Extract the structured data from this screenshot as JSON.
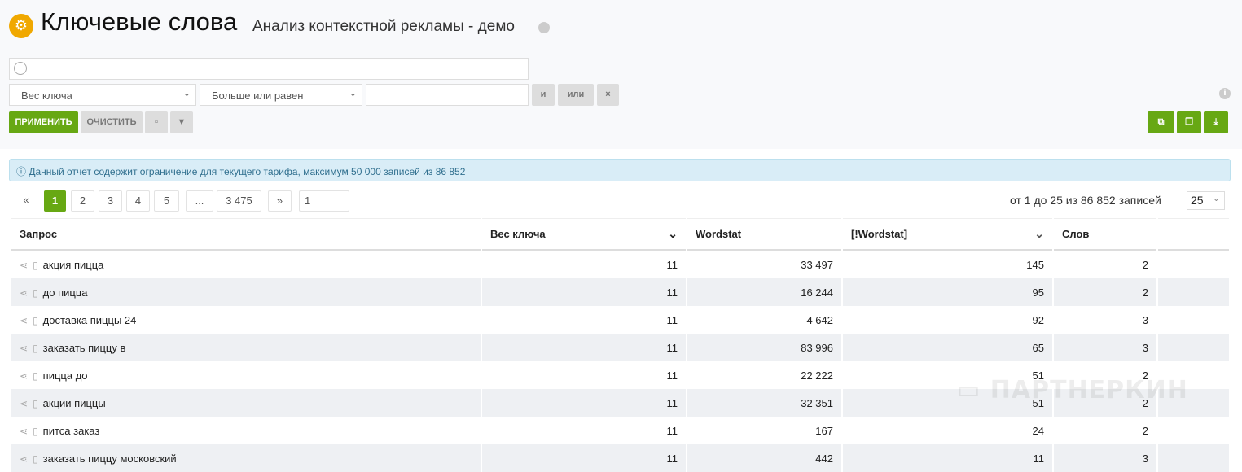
{
  "header": {
    "title": "Ключевые слова",
    "subtitle": "Анализ контекстной рекламы - демо"
  },
  "filters": {
    "search_placeholder": "",
    "field_select": "Вес ключа",
    "operator_select": "Больше или равен",
    "value": "",
    "and_label": "и",
    "or_label": "или",
    "remove_label": "×",
    "apply_label": "ПРИМЕНИТЬ",
    "clear_label": "ОЧИСТИТЬ"
  },
  "alert": "Данный отчет содержит ограничение для текущего тарифа, максимум 50 000 записей из 86 852",
  "pagination": {
    "prev": "«",
    "pages": [
      "1",
      "2",
      "3",
      "4",
      "5",
      "...",
      "3 475"
    ],
    "next": "»",
    "goto": "1",
    "records_info": "от 1 до 25 из 86 852 записей",
    "per_page": "25"
  },
  "table": {
    "columns": [
      "Запрос",
      "Вес ключа",
      "Wordstat",
      "[!Wordstat]",
      "Слов"
    ],
    "rows": [
      [
        "акция пицца",
        "11",
        "33 497",
        "145",
        "2"
      ],
      [
        "до пицца",
        "11",
        "16 244",
        "95",
        "2"
      ],
      [
        "доставка пиццы 24",
        "11",
        "4 642",
        "92",
        "3"
      ],
      [
        "заказать пиццу в",
        "11",
        "83 996",
        "65",
        "3"
      ],
      [
        "пицца до",
        "11",
        "22 222",
        "51",
        "2"
      ],
      [
        "акции пиццы",
        "11",
        "32 351",
        "51",
        "2"
      ],
      [
        "питса заказ",
        "11",
        "167",
        "24",
        "2"
      ],
      [
        "заказать пиццу московский",
        "11",
        "442",
        "11",
        "3"
      ]
    ]
  },
  "watermark": "ПАРТНЕРКИН",
  "colors": {
    "accent": "#67a813",
    "logo": "#f0a800"
  }
}
